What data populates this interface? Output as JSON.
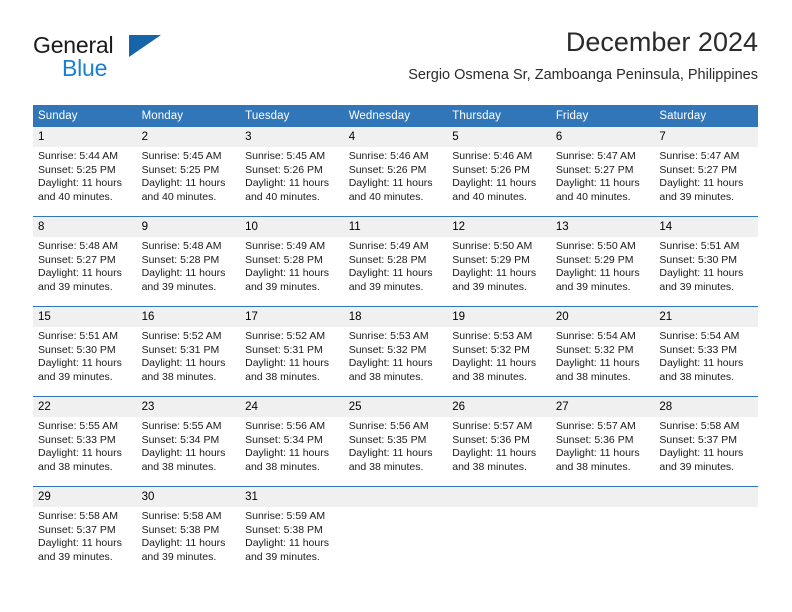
{
  "brand": {
    "name_top": "General",
    "name_bottom": "Blue",
    "triangle_icon": "brand-triangle-icon",
    "color_blue": "#1c7fd4",
    "color_triangle": "#1565a8"
  },
  "header": {
    "title": "December 2024",
    "subtitle": "Sergio Osmena Sr, Zamboanga Peninsula, Philippines"
  },
  "calendar": {
    "accent_color": "#3176b8",
    "daynum_background": "#f0f0f0",
    "weekday_headers": [
      "Sunday",
      "Monday",
      "Tuesday",
      "Wednesday",
      "Thursday",
      "Friday",
      "Saturday"
    ],
    "weeks": [
      [
        {
          "day": "1",
          "sunrise": "Sunrise: 5:44 AM",
          "sunset": "Sunset: 5:25 PM",
          "daylight_line1": "Daylight: 11 hours",
          "daylight_line2": "and 40 minutes."
        },
        {
          "day": "2",
          "sunrise": "Sunrise: 5:45 AM",
          "sunset": "Sunset: 5:25 PM",
          "daylight_line1": "Daylight: 11 hours",
          "daylight_line2": "and 40 minutes."
        },
        {
          "day": "3",
          "sunrise": "Sunrise: 5:45 AM",
          "sunset": "Sunset: 5:26 PM",
          "daylight_line1": "Daylight: 11 hours",
          "daylight_line2": "and 40 minutes."
        },
        {
          "day": "4",
          "sunrise": "Sunrise: 5:46 AM",
          "sunset": "Sunset: 5:26 PM",
          "daylight_line1": "Daylight: 11 hours",
          "daylight_line2": "and 40 minutes."
        },
        {
          "day": "5",
          "sunrise": "Sunrise: 5:46 AM",
          "sunset": "Sunset: 5:26 PM",
          "daylight_line1": "Daylight: 11 hours",
          "daylight_line2": "and 40 minutes."
        },
        {
          "day": "6",
          "sunrise": "Sunrise: 5:47 AM",
          "sunset": "Sunset: 5:27 PM",
          "daylight_line1": "Daylight: 11 hours",
          "daylight_line2": "and 40 minutes."
        },
        {
          "day": "7",
          "sunrise": "Sunrise: 5:47 AM",
          "sunset": "Sunset: 5:27 PM",
          "daylight_line1": "Daylight: 11 hours",
          "daylight_line2": "and 39 minutes."
        }
      ],
      [
        {
          "day": "8",
          "sunrise": "Sunrise: 5:48 AM",
          "sunset": "Sunset: 5:27 PM",
          "daylight_line1": "Daylight: 11 hours",
          "daylight_line2": "and 39 minutes."
        },
        {
          "day": "9",
          "sunrise": "Sunrise: 5:48 AM",
          "sunset": "Sunset: 5:28 PM",
          "daylight_line1": "Daylight: 11 hours",
          "daylight_line2": "and 39 minutes."
        },
        {
          "day": "10",
          "sunrise": "Sunrise: 5:49 AM",
          "sunset": "Sunset: 5:28 PM",
          "daylight_line1": "Daylight: 11 hours",
          "daylight_line2": "and 39 minutes."
        },
        {
          "day": "11",
          "sunrise": "Sunrise: 5:49 AM",
          "sunset": "Sunset: 5:28 PM",
          "daylight_line1": "Daylight: 11 hours",
          "daylight_line2": "and 39 minutes."
        },
        {
          "day": "12",
          "sunrise": "Sunrise: 5:50 AM",
          "sunset": "Sunset: 5:29 PM",
          "daylight_line1": "Daylight: 11 hours",
          "daylight_line2": "and 39 minutes."
        },
        {
          "day": "13",
          "sunrise": "Sunrise: 5:50 AM",
          "sunset": "Sunset: 5:29 PM",
          "daylight_line1": "Daylight: 11 hours",
          "daylight_line2": "and 39 minutes."
        },
        {
          "day": "14",
          "sunrise": "Sunrise: 5:51 AM",
          "sunset": "Sunset: 5:30 PM",
          "daylight_line1": "Daylight: 11 hours",
          "daylight_line2": "and 39 minutes."
        }
      ],
      [
        {
          "day": "15",
          "sunrise": "Sunrise: 5:51 AM",
          "sunset": "Sunset: 5:30 PM",
          "daylight_line1": "Daylight: 11 hours",
          "daylight_line2": "and 39 minutes."
        },
        {
          "day": "16",
          "sunrise": "Sunrise: 5:52 AM",
          "sunset": "Sunset: 5:31 PM",
          "daylight_line1": "Daylight: 11 hours",
          "daylight_line2": "and 38 minutes."
        },
        {
          "day": "17",
          "sunrise": "Sunrise: 5:52 AM",
          "sunset": "Sunset: 5:31 PM",
          "daylight_line1": "Daylight: 11 hours",
          "daylight_line2": "and 38 minutes."
        },
        {
          "day": "18",
          "sunrise": "Sunrise: 5:53 AM",
          "sunset": "Sunset: 5:32 PM",
          "daylight_line1": "Daylight: 11 hours",
          "daylight_line2": "and 38 minutes."
        },
        {
          "day": "19",
          "sunrise": "Sunrise: 5:53 AM",
          "sunset": "Sunset: 5:32 PM",
          "daylight_line1": "Daylight: 11 hours",
          "daylight_line2": "and 38 minutes."
        },
        {
          "day": "20",
          "sunrise": "Sunrise: 5:54 AM",
          "sunset": "Sunset: 5:32 PM",
          "daylight_line1": "Daylight: 11 hours",
          "daylight_line2": "and 38 minutes."
        },
        {
          "day": "21",
          "sunrise": "Sunrise: 5:54 AM",
          "sunset": "Sunset: 5:33 PM",
          "daylight_line1": "Daylight: 11 hours",
          "daylight_line2": "and 38 minutes."
        }
      ],
      [
        {
          "day": "22",
          "sunrise": "Sunrise: 5:55 AM",
          "sunset": "Sunset: 5:33 PM",
          "daylight_line1": "Daylight: 11 hours",
          "daylight_line2": "and 38 minutes."
        },
        {
          "day": "23",
          "sunrise": "Sunrise: 5:55 AM",
          "sunset": "Sunset: 5:34 PM",
          "daylight_line1": "Daylight: 11 hours",
          "daylight_line2": "and 38 minutes."
        },
        {
          "day": "24",
          "sunrise": "Sunrise: 5:56 AM",
          "sunset": "Sunset: 5:34 PM",
          "daylight_line1": "Daylight: 11 hours",
          "daylight_line2": "and 38 minutes."
        },
        {
          "day": "25",
          "sunrise": "Sunrise: 5:56 AM",
          "sunset": "Sunset: 5:35 PM",
          "daylight_line1": "Daylight: 11 hours",
          "daylight_line2": "and 38 minutes."
        },
        {
          "day": "26",
          "sunrise": "Sunrise: 5:57 AM",
          "sunset": "Sunset: 5:36 PM",
          "daylight_line1": "Daylight: 11 hours",
          "daylight_line2": "and 38 minutes."
        },
        {
          "day": "27",
          "sunrise": "Sunrise: 5:57 AM",
          "sunset": "Sunset: 5:36 PM",
          "daylight_line1": "Daylight: 11 hours",
          "daylight_line2": "and 38 minutes."
        },
        {
          "day": "28",
          "sunrise": "Sunrise: 5:58 AM",
          "sunset": "Sunset: 5:37 PM",
          "daylight_line1": "Daylight: 11 hours",
          "daylight_line2": "and 39 minutes."
        }
      ],
      [
        {
          "day": "29",
          "sunrise": "Sunrise: 5:58 AM",
          "sunset": "Sunset: 5:37 PM",
          "daylight_line1": "Daylight: 11 hours",
          "daylight_line2": "and 39 minutes."
        },
        {
          "day": "30",
          "sunrise": "Sunrise: 5:58 AM",
          "sunset": "Sunset: 5:38 PM",
          "daylight_line1": "Daylight: 11 hours",
          "daylight_line2": "and 39 minutes."
        },
        {
          "day": "31",
          "sunrise": "Sunrise: 5:59 AM",
          "sunset": "Sunset: 5:38 PM",
          "daylight_line1": "Daylight: 11 hours",
          "daylight_line2": "and 39 minutes."
        },
        {
          "day": "",
          "sunrise": "",
          "sunset": "",
          "daylight_line1": "",
          "daylight_line2": ""
        },
        {
          "day": "",
          "sunrise": "",
          "sunset": "",
          "daylight_line1": "",
          "daylight_line2": ""
        },
        {
          "day": "",
          "sunrise": "",
          "sunset": "",
          "daylight_line1": "",
          "daylight_line2": ""
        },
        {
          "day": "",
          "sunrise": "",
          "sunset": "",
          "daylight_line1": "",
          "daylight_line2": ""
        }
      ]
    ]
  }
}
